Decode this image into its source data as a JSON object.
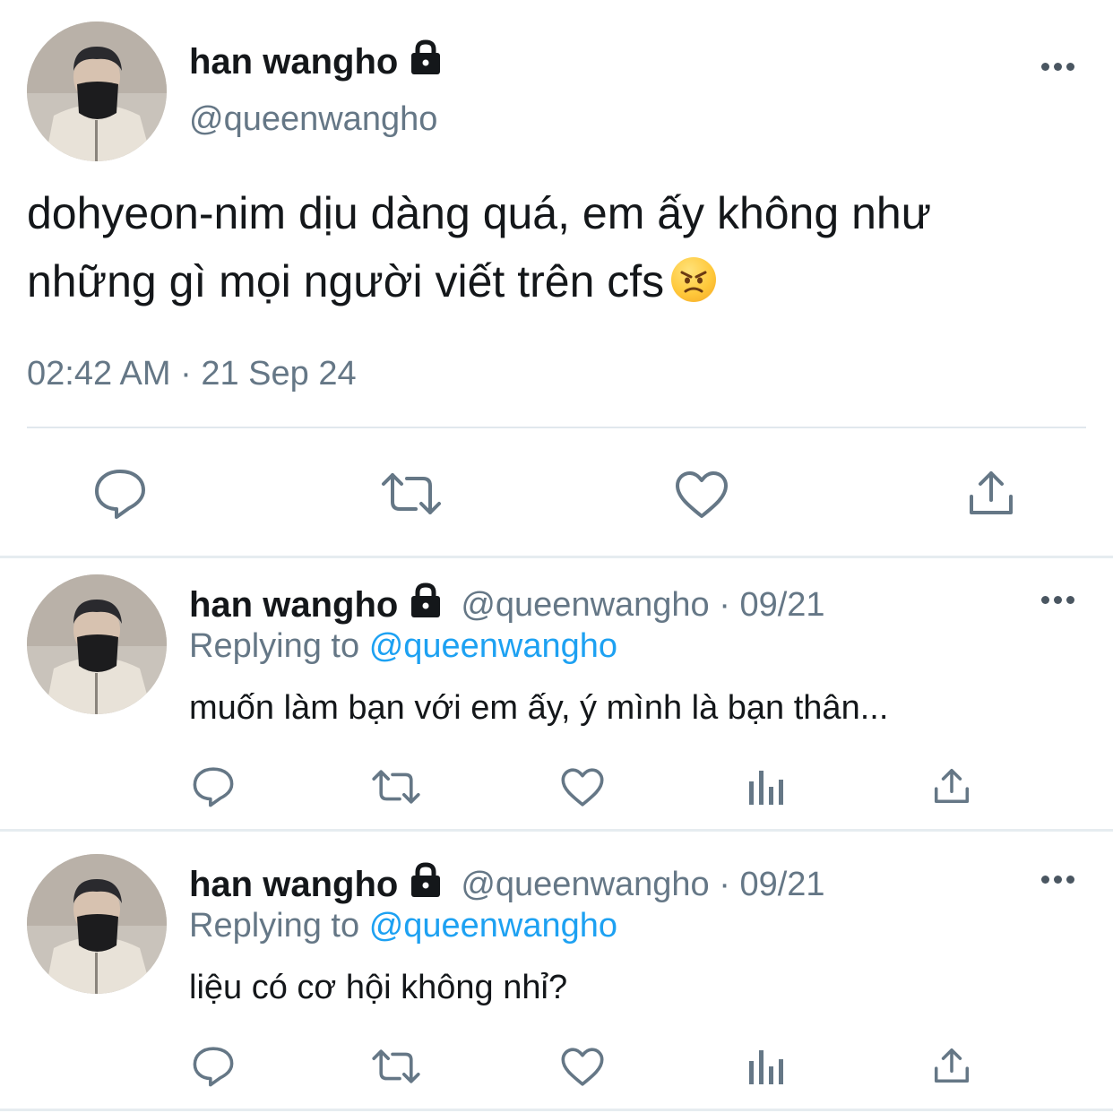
{
  "main_tweet": {
    "display_name": "han wangho",
    "handle": "@queenwangho",
    "text_line1": "dohyeon-nim dịu dàng quá, em ấy không như",
    "text_line2": "những gì mọi người viết trên cfs",
    "emoji": "angry-face",
    "timestamp": "02:42 AM · 21 Sep 24",
    "actions": [
      "reply-icon",
      "retweet-icon",
      "like-icon",
      "share-icon"
    ]
  },
  "replies": [
    {
      "display_name": "han wangho",
      "handle_date": "@queenwangho · 09/21",
      "replying_prefix": "Replying to",
      "replying_to": "@queenwangho",
      "text": "muốn làm bạn với em ấy, ý mình là bạn thân...",
      "actions": [
        "reply-icon",
        "retweet-icon",
        "like-icon",
        "analytics-icon",
        "share-icon"
      ]
    },
    {
      "display_name": "han wangho",
      "handle_date": "@queenwangho · 09/21",
      "replying_prefix": "Replying to",
      "replying_to": "@queenwangho",
      "text": "liệu có cơ hội không nhỉ?",
      "actions": [
        "reply-icon",
        "retweet-icon",
        "like-icon",
        "analytics-icon",
        "share-icon"
      ]
    }
  ],
  "colors": {
    "text": "#14171a",
    "secondary": "#657786",
    "link": "#1da1f2",
    "icon": "#657786"
  }
}
